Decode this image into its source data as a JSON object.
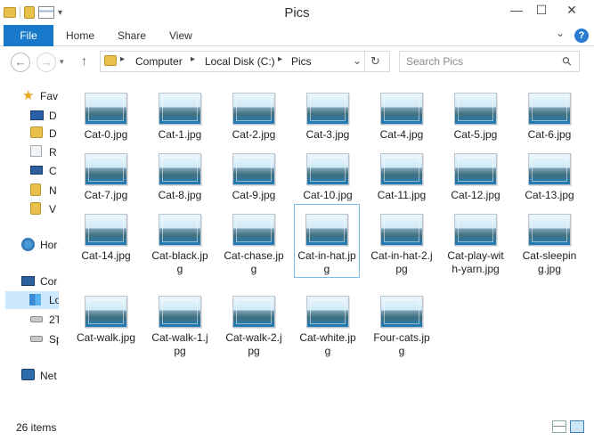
{
  "window": {
    "title": "Pics",
    "minimize": "—",
    "maximize": "☐",
    "close": "✕"
  },
  "ribbon": {
    "file": "File",
    "tabs": [
      "Home",
      "Share",
      "View"
    ],
    "expand": "⌄",
    "help": "?"
  },
  "nav": {
    "back": "←",
    "forward": "→",
    "up": "↑",
    "breadcrumbs": [
      "Computer",
      "Local Disk (C:)",
      "Pics"
    ],
    "refresh": "↻",
    "dropdown": "⌄",
    "search_placeholder": "Search Pics",
    "search_icon": "⚲"
  },
  "navpane": [
    {
      "label": "Fav",
      "icon": "star-icon"
    },
    {
      "label": "D",
      "icon": "desktop-icon"
    },
    {
      "label": "D",
      "icon": "downloads-icon"
    },
    {
      "label": "R",
      "icon": "recent-places-icon"
    },
    {
      "label": "C",
      "icon": "computer-icon"
    },
    {
      "label": "N",
      "icon": "folder-icon"
    },
    {
      "label": "V",
      "icon": "folder-icon"
    },
    {
      "label": "Hor",
      "icon": "homegroup-icon"
    },
    {
      "label": "Cor",
      "icon": "computer-icon"
    },
    {
      "label": "Lo",
      "icon": "local-disk-icon"
    },
    {
      "label": "2T",
      "icon": "drive-icon"
    },
    {
      "label": "Sp",
      "icon": "drive-icon"
    },
    {
      "label": "Net",
      "icon": "network-icon"
    }
  ],
  "files": [
    [
      "Cat-0.jpg",
      "Cat-1.jpg",
      "Cat-2.jpg",
      "Cat-3.jpg",
      "Cat-4.jpg",
      "Cat-5.jpg",
      "Cat-6.jpg"
    ],
    [
      "Cat-7.jpg",
      "Cat-8.jpg",
      "Cat-9.jpg",
      "Cat-10.jpg",
      "Cat-11.jpg",
      "Cat-12.jpg",
      "Cat-13.jpg"
    ],
    [
      "Cat-14.jpg",
      "Cat-black.jpg",
      "Cat-chase.jpg",
      "Cat-in-hat.jpg",
      "Cat-in-hat-2.jpg",
      "Cat-play-with-yarn.jpg",
      "Cat-sleeping.jpg"
    ],
    [
      "Cat-walk.jpg",
      "Cat-walk-1.jpg",
      "Cat-walk-2.jpg",
      "Cat-white.jpg",
      "Four-cats.jpg"
    ]
  ],
  "selected_file": "Cat-in-hat.jpg",
  "status": {
    "item_count": "26 items"
  },
  "colors": {
    "accent": "#1979ca",
    "selection_border": "#7dbdea",
    "nav_selection": "#cce8ff"
  }
}
